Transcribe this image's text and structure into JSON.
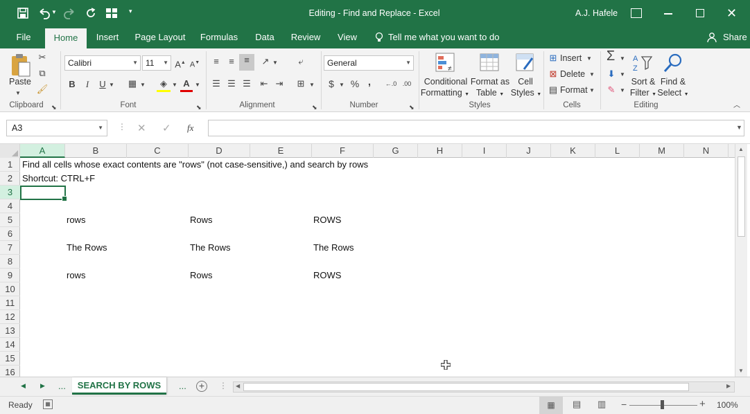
{
  "window": {
    "title": "Editing - Find and Replace  -  Excel",
    "user": "A.J. Hafele"
  },
  "ribbon_tabs": [
    "File",
    "Home",
    "Insert",
    "Page Layout",
    "Formulas",
    "Data",
    "Review",
    "View"
  ],
  "tell_me": "Tell me what you want to do",
  "share_label": "Share",
  "ribbon": {
    "clipboard": {
      "paste": "Paste",
      "group": "Clipboard"
    },
    "font": {
      "name": "Calibri",
      "size": "11",
      "group": "Font",
      "bold": "B",
      "italic": "I",
      "underline": "U"
    },
    "alignment": {
      "group": "Alignment"
    },
    "number": {
      "format": "General",
      "group": "Number",
      "currency": "$",
      "percent": "%",
      "comma": ","
    },
    "styles": {
      "conditional": "Conditional",
      "conditional2": "Formatting",
      "format_as": "Format as",
      "format_as2": "Table",
      "cell": "Cell",
      "cell2": "Styles",
      "group": "Styles"
    },
    "cells": {
      "insert": "Insert",
      "delete": "Delete",
      "format": "Format",
      "group": "Cells"
    },
    "editing": {
      "sort": "Sort &",
      "sort2": "Filter",
      "find": "Find &",
      "find2": "Select",
      "group": "Editing"
    }
  },
  "formula_bar": {
    "name_box": "A3",
    "fx": "fx",
    "value": ""
  },
  "columns": [
    "A",
    "B",
    "C",
    "D",
    "E",
    "F",
    "G",
    "H",
    "I",
    "J",
    "K",
    "L",
    "M",
    "N"
  ],
  "rows": [
    "1",
    "2",
    "3",
    "4",
    "5",
    "6",
    "7",
    "8",
    "9",
    "10",
    "11",
    "12",
    "13",
    "14",
    "15",
    "16"
  ],
  "cells": {
    "A1": "Find all cells whose exact contents are \"rows\" (not case-sensitive,) and search by rows",
    "A2": "Shortcut: CTRL+F",
    "B5": "rows",
    "D5": "Rows",
    "F5": "ROWS",
    "B7": "The Rows",
    "D7": "The Rows",
    "F7": "The Rows",
    "B9": "rows",
    "D9": "Rows",
    "F9": "ROWS"
  },
  "sheet_tab": "SEARCH BY ROWS",
  "sheet_ellipsis": "...",
  "status": {
    "ready": "Ready",
    "zoom": "100%"
  },
  "colors": {
    "accent": "#217346"
  }
}
